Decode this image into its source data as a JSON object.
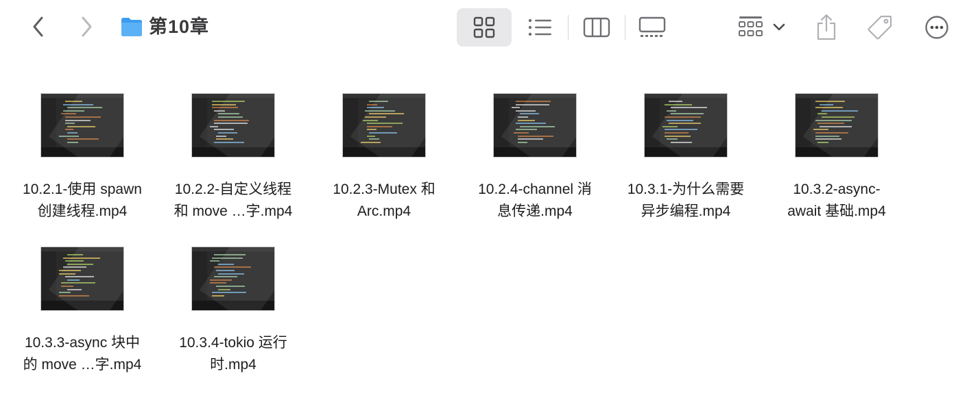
{
  "window": {
    "title": "第10章",
    "back_icon": "chevron-left-icon",
    "forward_icon": "chevron-right-icon",
    "folder_icon": "folder-icon"
  },
  "toolbar": {
    "view_modes": [
      "icon-view",
      "list-view",
      "column-view",
      "gallery-view"
    ],
    "selected_view": "icon-view",
    "group_icon": "group-by-icon",
    "share_icon": "share-icon",
    "tag_icon": "tag-icon",
    "more_icon": "more-icon"
  },
  "files": [
    {
      "line1": "10.2.1-使用 spawn",
      "line2": "创建线程.mp4"
    },
    {
      "line1": "10.2.2-自定义线程",
      "line2": "和 move …字.mp4"
    },
    {
      "line1": "10.2.3-Mutex 和",
      "line2": "Arc.mp4"
    },
    {
      "line1": "10.2.4-channel 消",
      "line2": "息传递.mp4"
    },
    {
      "line1": "10.3.1-为什么需要",
      "line2": "异步编程.mp4"
    },
    {
      "line1": "10.3.2-async-",
      "line2": "await 基础.mp4"
    },
    {
      "line1": "10.3.3-async 块中",
      "line2": "的 move …字.mp4"
    },
    {
      "line1": "10.3.4-tokio 运行",
      "line2": "时.mp4"
    }
  ],
  "colors": {
    "folder_blue": "#5ab1f5",
    "icon_gray": "#6e6e73",
    "selected_bg": "#e8e8ea",
    "thumb_bg": "#161616"
  }
}
